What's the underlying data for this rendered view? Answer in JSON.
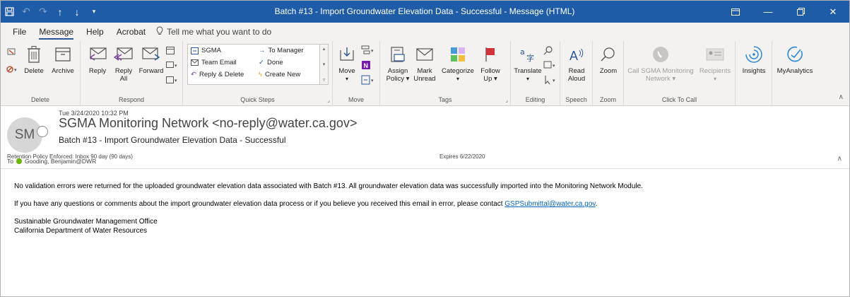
{
  "window": {
    "title": "Batch #13 - Import Groundwater Elevation Data - Successful  -  Message (HTML)",
    "colors": {
      "titlebar": "#1f5ca8",
      "link": "#0563c1",
      "presence_green": "#6bb700"
    }
  },
  "tabs": [
    "File",
    "Message",
    "Help",
    "Acrobat"
  ],
  "tell_me": "Tell me what you want to do",
  "ribbon": {
    "delete_group": {
      "label": "Delete",
      "delete": "Delete",
      "archive": "Archive"
    },
    "respond_group": {
      "label": "Respond",
      "reply": "Reply",
      "reply_all_1": "Reply",
      "reply_all_2": "All",
      "forward": "Forward"
    },
    "quick_steps": {
      "label": "Quick Steps",
      "items": [
        "SGMA",
        "Team Email",
        "Reply & Delete",
        "To Manager",
        "Done",
        "Create New"
      ]
    },
    "move_group": {
      "label": "Move",
      "move": "Move"
    },
    "tags_group": {
      "label": "Tags",
      "assign_1": "Assign",
      "assign_2": "Policy ▾",
      "mark_1": "Mark",
      "mark_2": "Unread",
      "categorize": "Categorize",
      "follow_1": "Follow",
      "follow_2": "Up ▾"
    },
    "editing_group": {
      "label": "Editing",
      "translate": "Translate"
    },
    "speech_group": {
      "label": "Speech",
      "read_1": "Read",
      "read_2": "Aloud"
    },
    "zoom_group": {
      "label": "Zoom",
      "zoom": "Zoom"
    },
    "click_to_call": {
      "label": "Click To Call",
      "call_1": "Call  SGMA Monitoring",
      "call_2": "Network ▾",
      "recipients": "Recipients"
    },
    "insights": "Insights",
    "myanalytics": "MyAnalytics"
  },
  "message": {
    "date": "Tue 3/24/2020 10:32 PM",
    "avatar_initials": "SM",
    "from": "SGMA Monitoring Network <no-reply@water.ca.gov>",
    "subject": "Batch #13 - Import Groundwater Elevation Data - Successful",
    "to_label": "To",
    "to_name": "Gooding, Benjamin@DWR",
    "retention": "Retention Policy   Enforced: Inbox 90 day (90 days)",
    "expires": "Expires   6/22/2020",
    "body_p1": "No validation errors were returned for the uploaded groundwater elevation data associated with Batch #13. All groundwater elevation data was successfully imported into the Monitoring Network Module.",
    "body_p2": "If you have any questions or comments about the import groundwater elevation data process or if you believe you received this email in error, please contact ",
    "body_link": "GSPSubmittal@water.ca.gov",
    "body_p2_end": ".",
    "sig_1": "Sustainable Groundwater Management Office",
    "sig_2": "California Department of Water Resources"
  }
}
